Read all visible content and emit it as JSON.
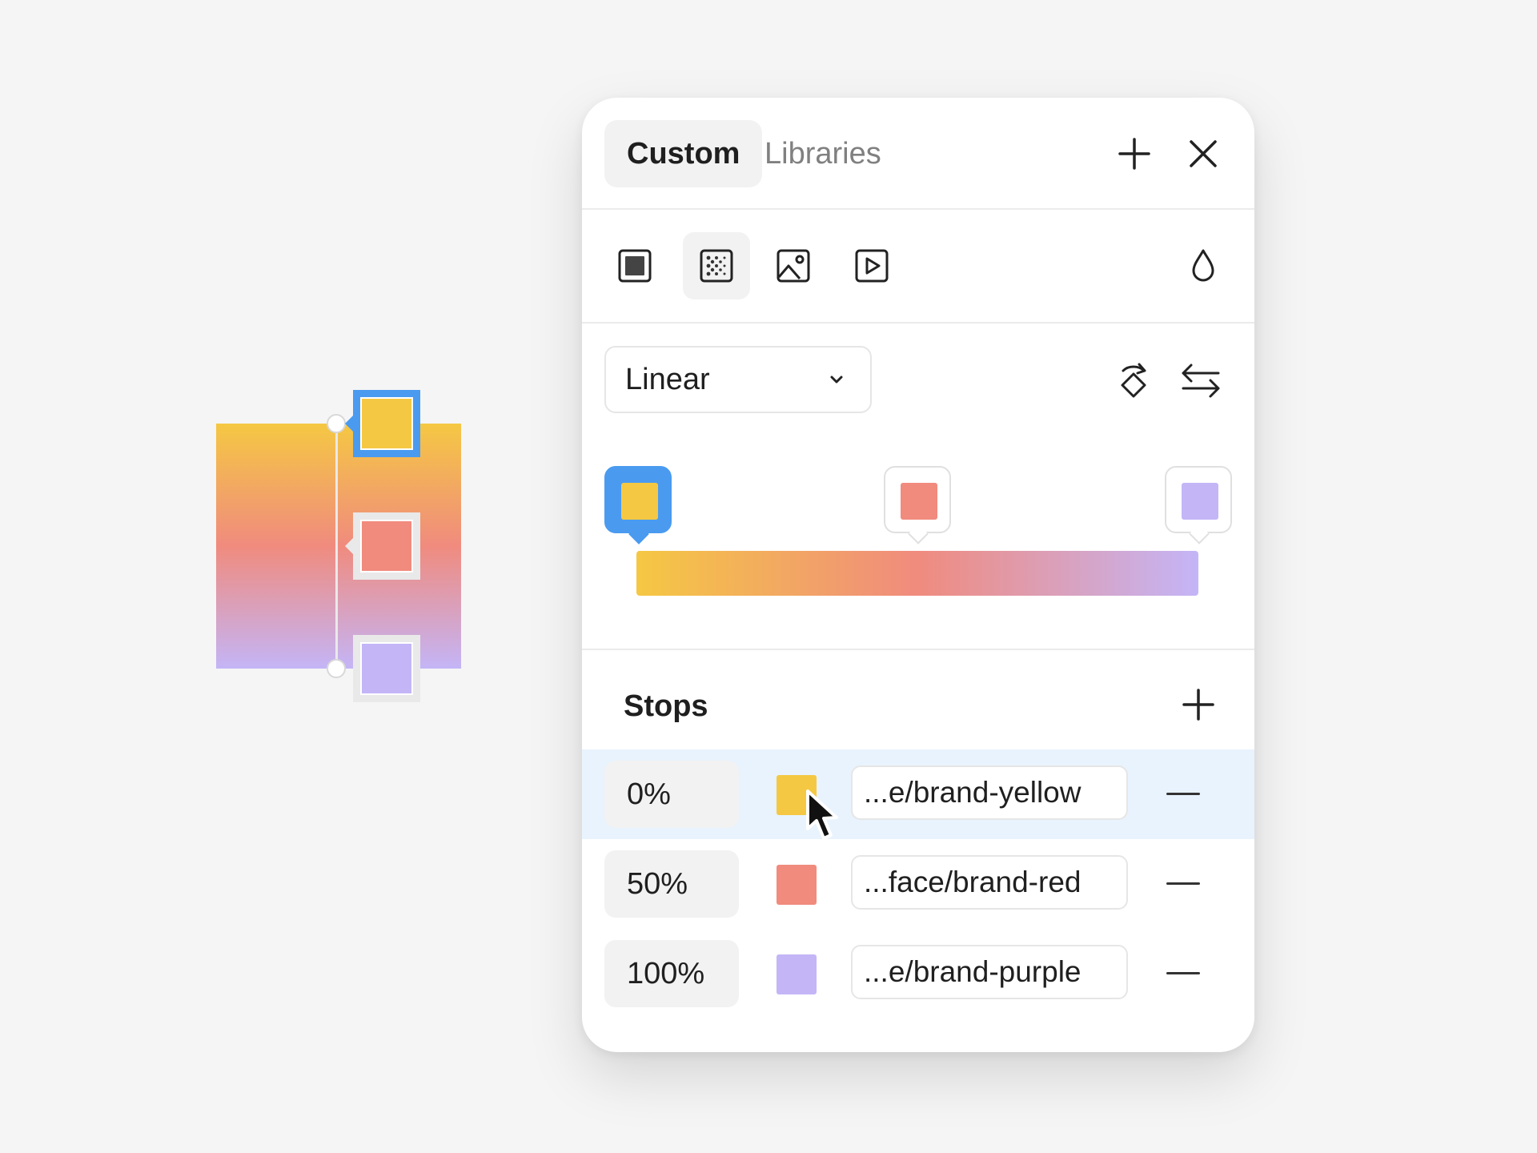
{
  "canvas": {
    "preview_colors": [
      "#f5c843",
      "#f08b7e",
      "#c4b5f7"
    ]
  },
  "panel": {
    "tabs": [
      {
        "label": "Custom",
        "active": true
      },
      {
        "label": "Libraries",
        "active": false
      }
    ],
    "header_icons": [
      "plus-icon",
      "close-icon"
    ],
    "fill_types": [
      {
        "icon": "solid-fill-icon",
        "active": false
      },
      {
        "icon": "gradient-fill-icon",
        "active": true
      },
      {
        "icon": "image-fill-icon",
        "active": false
      },
      {
        "icon": "video-fill-icon",
        "active": false
      }
    ],
    "eyedropper_icon": "droplet-icon",
    "gradient": {
      "type": "Linear",
      "actions": [
        "rotate-icon",
        "flip-icon"
      ]
    },
    "stops_title": "Stops",
    "stops": [
      {
        "position": "0%",
        "color": "#f5c843",
        "token": "...e/brand-yellow",
        "selected": true
      },
      {
        "position": "50%",
        "color": "#f08b7e",
        "token": "...face/brand-red",
        "selected": false
      },
      {
        "position": "100%",
        "color": "#c4b5f7",
        "token": "...e/brand-purple",
        "selected": false
      }
    ]
  },
  "colors": {
    "accent": "#4a9bf0",
    "selected_row": "#e8f3fd"
  }
}
